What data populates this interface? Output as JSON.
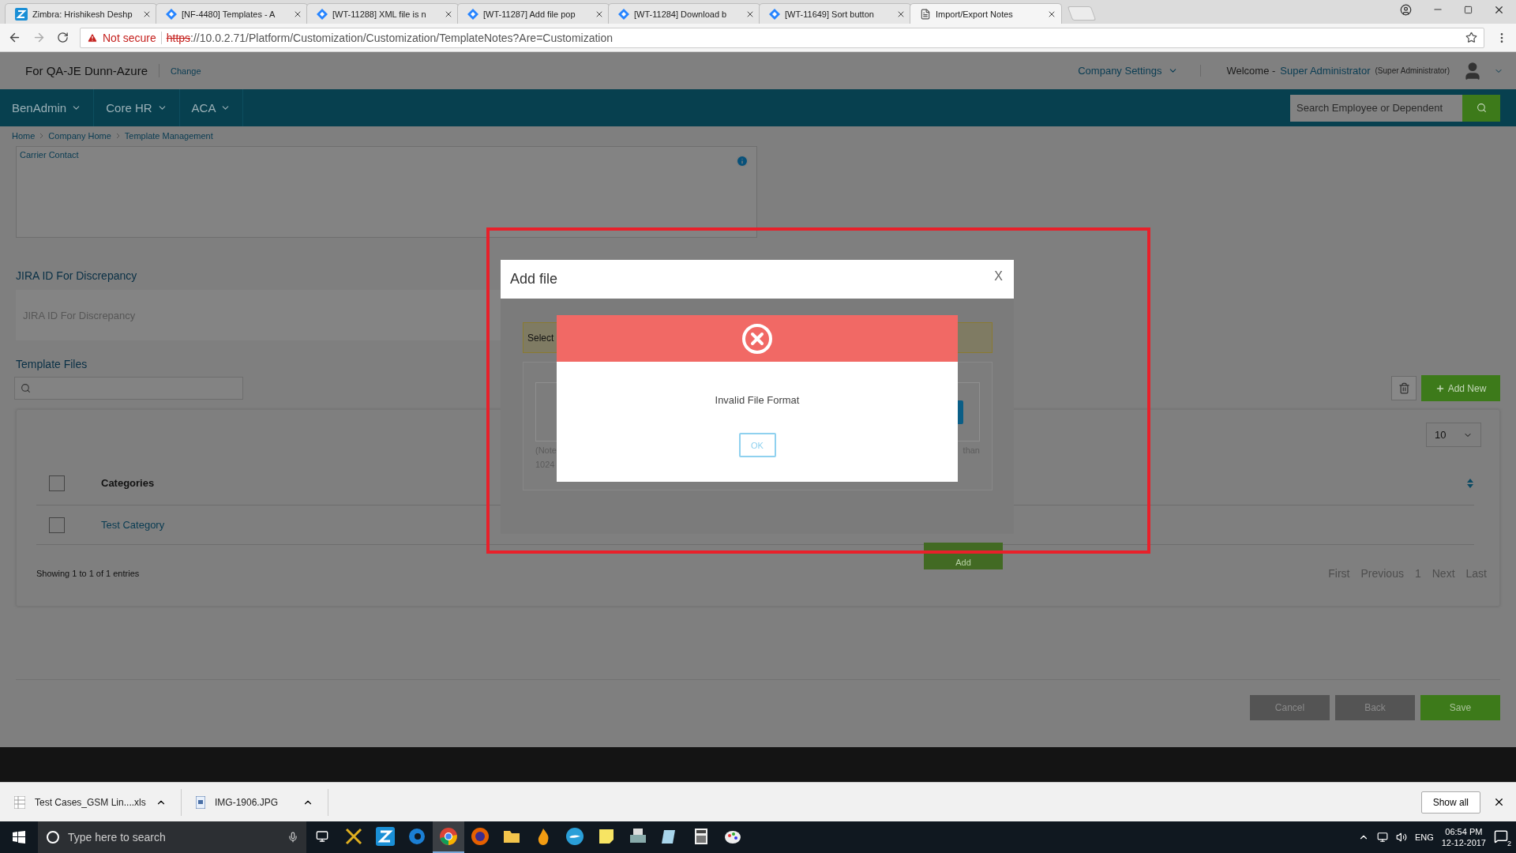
{
  "browser": {
    "tabs": [
      {
        "title": "Zimbra: Hrishikesh Deshp",
        "kind": "zimbra",
        "selected": false
      },
      {
        "title": "[NF-4480] Templates - A",
        "kind": "jira",
        "selected": false
      },
      {
        "title": "[WT-11288] XML file is n",
        "kind": "jira",
        "selected": false
      },
      {
        "title": "[WT-11287] Add file pop",
        "kind": "jira",
        "selected": false
      },
      {
        "title": "[WT-11284] Download b",
        "kind": "jira",
        "selected": false
      },
      {
        "title": "[WT-11649] Sort button",
        "kind": "jira",
        "selected": false
      },
      {
        "title": "Import/Export Notes",
        "kind": "page",
        "selected": true
      }
    ],
    "security": "Not secure",
    "url_scheme": "https",
    "url_rest": "://10.0.2.71/Platform/Customization/Customization/TemplateNotes?Are=Customization"
  },
  "header": {
    "company": "For QA-JE Dunn-Azure",
    "change_link": "Change",
    "settings": "Company Settings",
    "welcome": "Welcome -",
    "user": "Super Administrator",
    "role": "(Super Administrator)"
  },
  "nav": {
    "items": [
      "BenAdmin",
      "Core HR",
      "ACA"
    ],
    "search": {
      "placeholder": "Search Employee or Dependent"
    }
  },
  "breadcrumb": [
    "Home",
    "Company Home",
    "Template Management"
  ],
  "carrier_contact": {
    "label": "Carrier Contact"
  },
  "jira_field": {
    "label": "JIRA ID For Discrepancy",
    "placeholder": "JIRA ID For Discrepancy"
  },
  "template_files": {
    "label": "Template Files",
    "add_new": "Add New",
    "page_size": "10",
    "table": {
      "column": "Categories",
      "all_checked": false,
      "rows": [
        {
          "label": "Test Category",
          "checked": false
        }
      ]
    },
    "summary": "Showing 1 to 1 of 1 entries",
    "pager": [
      "First",
      "Previous",
      "1",
      "Next",
      "Last"
    ]
  },
  "actions": [
    "Cancel",
    "Back",
    "Save"
  ],
  "dialog": {
    "title": "Add file",
    "close": "X",
    "notice": "Select",
    "note_lines": [
      "(Note",
      "1024"
    ],
    "note_tail": "than",
    "add_button": "Add"
  },
  "alert": {
    "message": "Invalid File Format",
    "button": "OK"
  },
  "downloads": {
    "files": [
      {
        "name": "Test Cases_GSM Lin....xls",
        "kind": "sheet"
      },
      {
        "name": "IMG-1906.JPG",
        "kind": "image"
      }
    ],
    "show_all": "Show all"
  },
  "taskbar": {
    "search_placeholder": "Type here to search",
    "apps": [
      {
        "kind": "tools",
        "selected": false
      },
      {
        "kind": "zimbra",
        "selected": false
      },
      {
        "kind": "edge",
        "selected": false
      },
      {
        "kind": "chrome",
        "selected": true
      },
      {
        "kind": "firefox",
        "selected": false
      },
      {
        "kind": "folder",
        "selected": false
      },
      {
        "kind": "flame",
        "selected": false
      },
      {
        "kind": "bird",
        "selected": false
      },
      {
        "kind": "note",
        "selected": false
      },
      {
        "kind": "printer",
        "selected": false
      },
      {
        "kind": "paper",
        "selected": false
      },
      {
        "kind": "calculator",
        "selected": false
      },
      {
        "kind": "paint",
        "selected": false
      }
    ],
    "language": "ENG",
    "time": "06:54 PM",
    "date": "12-12-2017",
    "notifications": "2"
  }
}
